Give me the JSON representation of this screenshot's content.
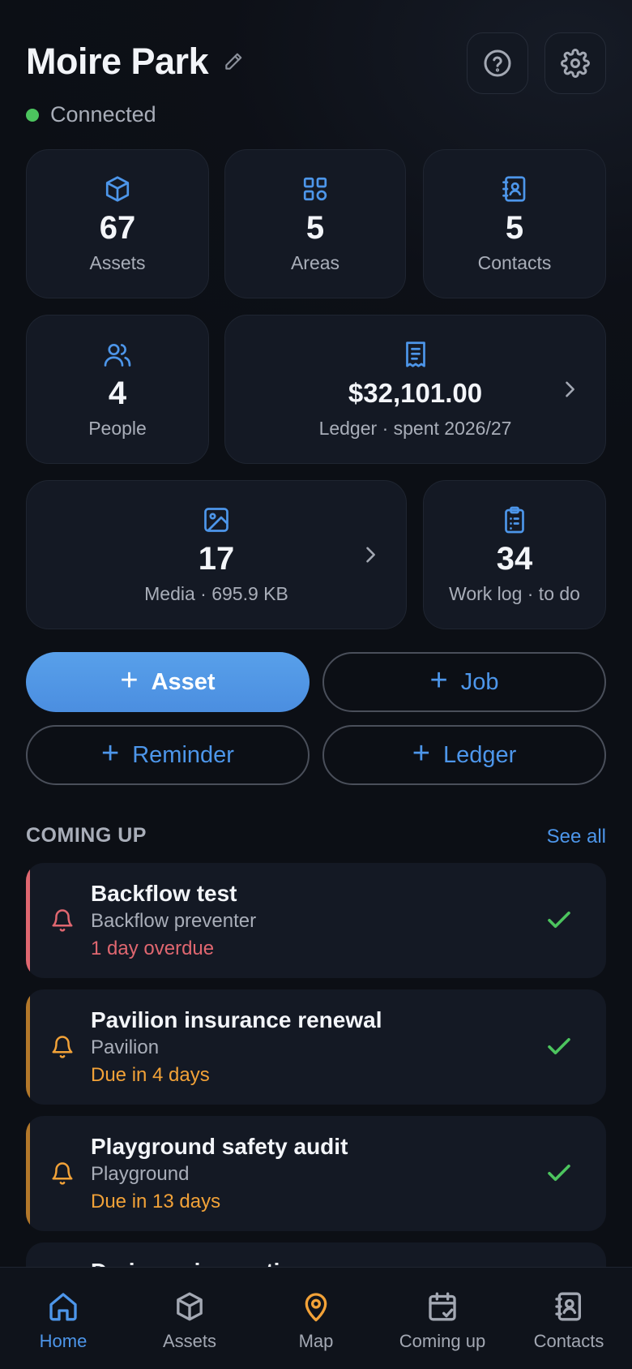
{
  "header": {
    "title": "Moire Park",
    "status": "Connected",
    "colors": {
      "status_dot": "#4cc45e"
    }
  },
  "stats": {
    "assets": {
      "value": "67",
      "label": "Assets",
      "icon": "cube-icon"
    },
    "areas": {
      "value": "5",
      "label": "Areas",
      "icon": "grid-icon"
    },
    "contacts": {
      "value": "5",
      "label": "Contacts",
      "icon": "address-book-icon"
    },
    "people": {
      "value": "4",
      "label": "People",
      "icon": "users-icon"
    },
    "ledger": {
      "value": "$32,101.00",
      "label": "Ledger · spent 2026/27",
      "icon": "receipt-icon"
    },
    "media": {
      "value": "17",
      "label": "Media · 695.9 KB",
      "icon": "image-icon"
    },
    "worklog": {
      "value": "34",
      "label": "Work log · to do",
      "icon": "clipboard-icon"
    }
  },
  "actions": {
    "asset": "Asset",
    "job": "Job",
    "reminder": "Reminder",
    "ledger": "Ledger",
    "plus": "+"
  },
  "coming_up": {
    "title": "COMING UP",
    "see_all": "See all",
    "items": [
      {
        "title": "Backflow test",
        "subtitle": "Backflow preventer",
        "due": "1 day overdue",
        "color": "#e06770"
      },
      {
        "title": "Pavilion insurance renewal",
        "subtitle": "Pavilion",
        "due": "Due in 4 days",
        "color": "#f2a238"
      },
      {
        "title": "Playground safety audit",
        "subtitle": "Playground",
        "due": "Due in 13 days",
        "color": "#f2a238"
      }
    ],
    "peek_title": "Drainage inspection"
  },
  "nav": {
    "home": "Home",
    "assets": "Assets",
    "map": "Map",
    "coming_up": "Coming up",
    "contacts": "Contacts"
  },
  "colors": {
    "accent": "#4d96ea",
    "check": "#4cc45e",
    "map_active": "#f2a238"
  }
}
